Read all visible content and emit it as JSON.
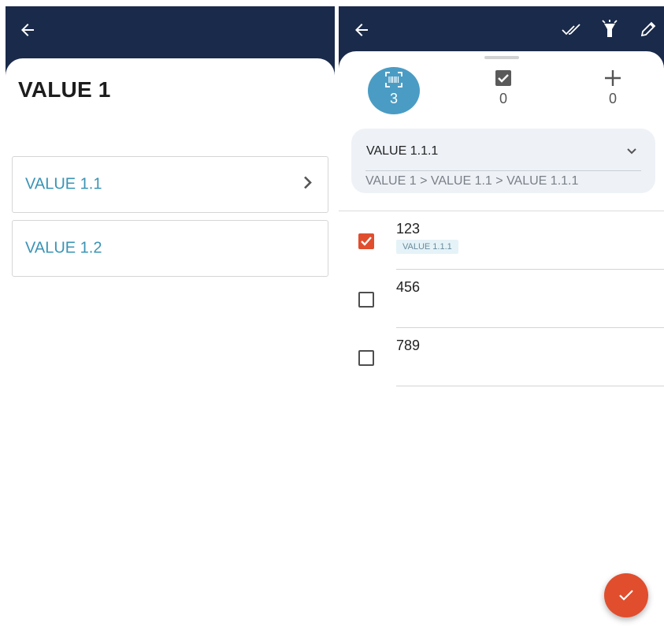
{
  "left_screen": {
    "title": "VALUE 1",
    "items": [
      {
        "label": "VALUE 1.1",
        "has_children": true
      },
      {
        "label": "VALUE 1.2",
        "has_children": false
      }
    ]
  },
  "right_screen": {
    "counters": [
      {
        "icon": "barcode-scan-icon",
        "value": "3",
        "active": true
      },
      {
        "icon": "checked-box-icon",
        "value": "0",
        "active": false
      },
      {
        "icon": "plus-icon",
        "value": "0",
        "active": false
      }
    ],
    "location_select": {
      "value": "VALUE 1.1.1",
      "path": "VALUE 1 > VALUE 1.1 > VALUE 1.1.1"
    },
    "rows": [
      {
        "code": "123",
        "checked": true,
        "tag": "VALUE 1.1.1"
      },
      {
        "code": "456",
        "checked": false,
        "tag": ""
      },
      {
        "code": "789",
        "checked": false,
        "tag": ""
      }
    ]
  },
  "colors": {
    "app_bar": "#1a2a4a",
    "link_text": "#3a93b5",
    "accent_active": "#4a9cc4",
    "accent_action": "#e04e2e"
  }
}
